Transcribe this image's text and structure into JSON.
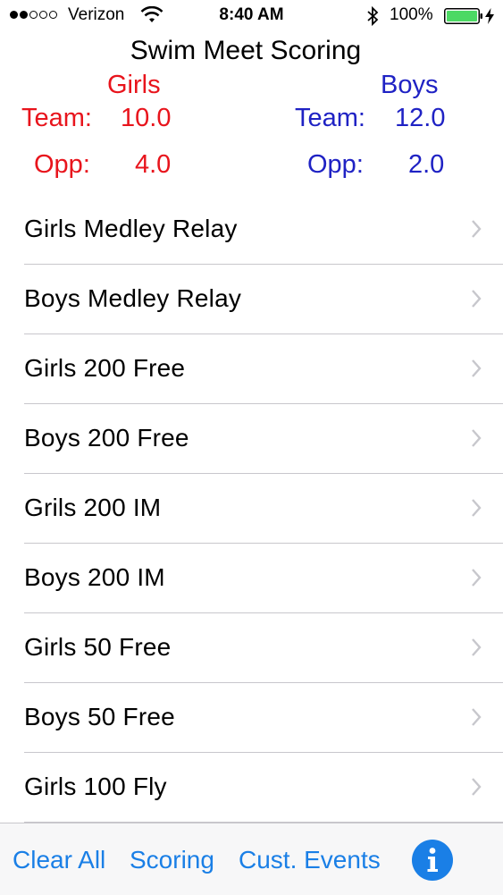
{
  "status_bar": {
    "carrier": "Verizon",
    "time": "8:40 AM",
    "battery": "100%"
  },
  "app": {
    "title": "Swim Meet Scoring"
  },
  "girls": {
    "header": "Girls",
    "team_label": "Team:",
    "team_score": "10.0",
    "opp_label": "Opp:",
    "opp_score": "4.0",
    "color": "#e8141c"
  },
  "boys": {
    "header": "Boys",
    "team_label": "Team:",
    "team_score": "12.0",
    "opp_label": "Opp:",
    "opp_score": "2.0",
    "color": "#1f22c4"
  },
  "events": [
    {
      "label": "Girls Medley Relay"
    },
    {
      "label": "Boys Medley Relay"
    },
    {
      "label": "Girls 200 Free"
    },
    {
      "label": "Boys 200 Free"
    },
    {
      "label": "Grils 200 IM"
    },
    {
      "label": "Boys 200 IM"
    },
    {
      "label": "Girls 50 Free"
    },
    {
      "label": "Boys 50 Free"
    },
    {
      "label": "Girls 100 Fly"
    },
    {
      "label": ""
    }
  ],
  "toolbar": {
    "clear_all": "Clear All",
    "scoring": "Scoring",
    "custom_events": "Cust. Events",
    "info_icon": "info-icon"
  },
  "icons": {
    "wifi": "wifi-icon",
    "bluetooth": "bluetooth-icon",
    "battery": "battery-icon",
    "charging": "charging-bolt-icon",
    "chevron": "chevron-right-icon"
  },
  "colors": {
    "accent": "#1a7fe6",
    "battery_fill": "#4cd964"
  }
}
